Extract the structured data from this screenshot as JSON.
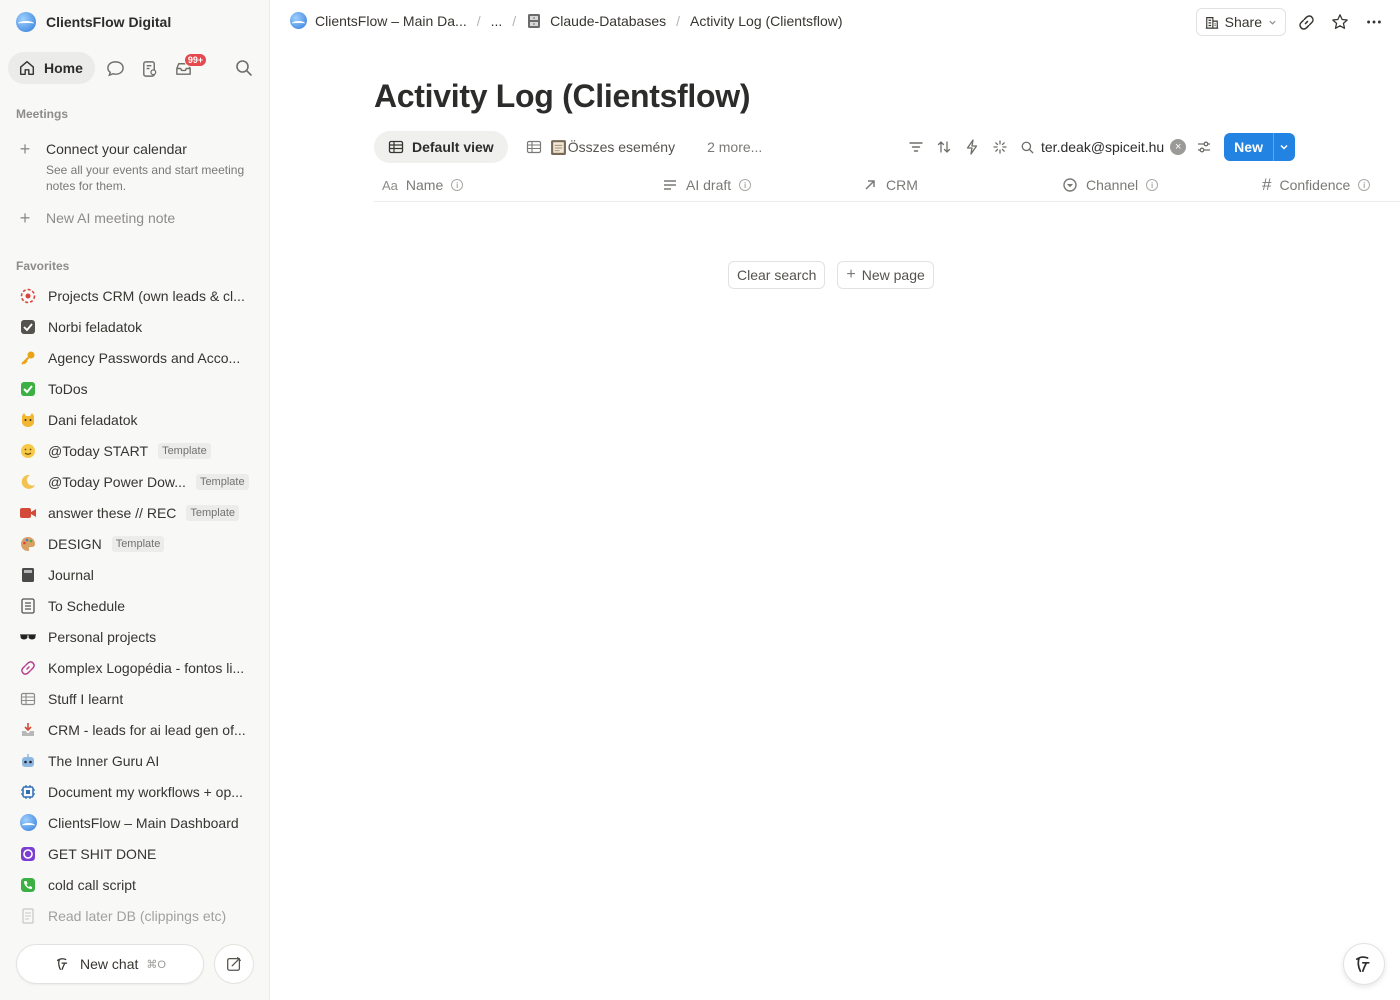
{
  "workspace": {
    "name": "ClientsFlow Digital"
  },
  "nav": {
    "home_label": "Home",
    "inbox_badge": "99+"
  },
  "meetings": {
    "section_title": "Meetings",
    "connect_title": "Connect your calendar",
    "connect_desc": "See all your events and start meeting notes for them.",
    "new_ai_note": "New AI meeting note"
  },
  "favorites": {
    "section_title": "Favorites",
    "items": [
      {
        "label": "Projects CRM (own leads & cl...",
        "icon": "target-icon"
      },
      {
        "label": "Norbi feladatok",
        "icon": "checkbox-icon"
      },
      {
        "label": "Agency Passwords and Acco...",
        "icon": "key-icon"
      },
      {
        "label": "ToDos",
        "icon": "check-mark-icon"
      },
      {
        "label": "Dani feladatok",
        "icon": "cat-icon"
      },
      {
        "label": "@Today START",
        "icon": "smiley-icon",
        "tag": "Template"
      },
      {
        "label": "@Today Power Dow...",
        "icon": "moon-icon",
        "tag": "Template"
      },
      {
        "label": "answer these // REC",
        "icon": "video-camera-icon",
        "tag": "Template"
      },
      {
        "label": "DESIGN",
        "icon": "palette-icon",
        "tag": "Template"
      },
      {
        "label": "Journal",
        "icon": "notebook-icon"
      },
      {
        "label": "To Schedule",
        "icon": "list-icon"
      },
      {
        "label": "Personal projects",
        "icon": "sunglasses-icon"
      },
      {
        "label": "Komplex Logopédia - fontos li...",
        "icon": "link-icon"
      },
      {
        "label": "Stuff I learnt",
        "icon": "table-icon"
      },
      {
        "label": "CRM - leads for ai lead gen of...",
        "icon": "inbox-tray-icon"
      },
      {
        "label": "The Inner Guru AI",
        "icon": "robot-icon"
      },
      {
        "label": "Document my workflows + op...",
        "icon": "chip-icon"
      },
      {
        "label": "ClientsFlow – Main Dashboard",
        "icon": "clientsflow-logo-icon"
      },
      {
        "label": "GET SHIT DONE",
        "icon": "app-icon"
      },
      {
        "label": "cold call script",
        "icon": "phone-icon"
      },
      {
        "label": "Read later DB (clippings etc)",
        "icon": "document-icon"
      }
    ]
  },
  "bottom": {
    "new_chat_label": "New chat",
    "new_chat_shortcut": "⌘O"
  },
  "breadcrumbs": {
    "c1": "ClientsFlow – Main Da...",
    "c2": "...",
    "c3": "Claude-Databases",
    "c4": "Activity Log (Clientsflow)"
  },
  "topbar": {
    "share_label": "Share"
  },
  "page": {
    "title": "Activity Log (Clientsflow)"
  },
  "views": {
    "default": "Default view",
    "all_events": "Összes esemény",
    "more": "2 more..."
  },
  "search": {
    "value": "ter.deak@spiceit.hu"
  },
  "new_button": {
    "label": "New"
  },
  "columns": {
    "name": "Name",
    "ai_draft": "AI draft",
    "crm": "CRM",
    "channel": "Channel",
    "confidence": "Confidence"
  },
  "empty_state": {
    "clear_search": "Clear search",
    "new_page": "New page"
  },
  "colors": {
    "accent": "#2383e2",
    "badge": "#e5484d"
  }
}
